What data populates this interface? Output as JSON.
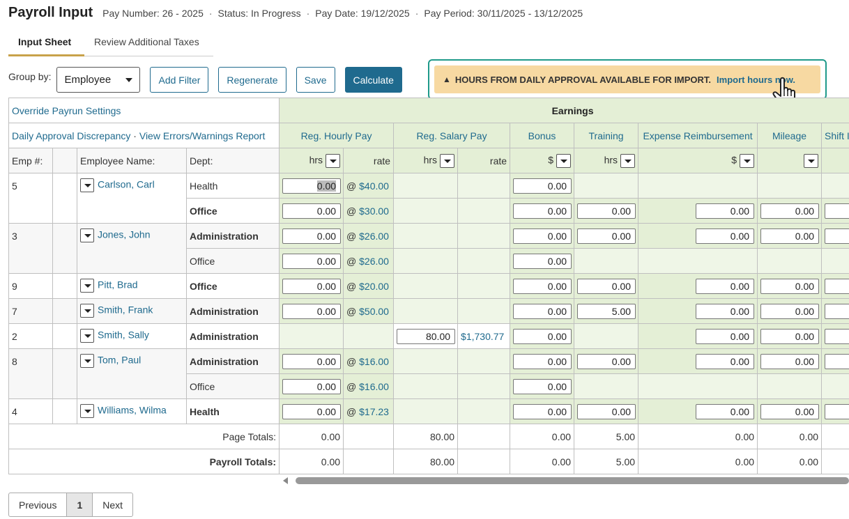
{
  "header": {
    "title": "Payroll Input",
    "pay_number": "Pay Number: 26 - 2025",
    "status": "Status: In Progress",
    "pay_date": "Pay Date: 19/12/2025",
    "pay_period": "Pay Period: 30/11/2025 - 13/12/2025"
  },
  "tabs": [
    "Input Sheet",
    "Review Additional Taxes"
  ],
  "toolbar": {
    "group_by_label": "Group by:",
    "group_by_value": "Employee",
    "add_filter": "Add Filter",
    "regenerate": "Regenerate",
    "save": "Save",
    "calculate": "Calculate"
  },
  "banner": {
    "message": "HOURS FROM DAILY APPROVAL AVAILABLE FOR IMPORT.",
    "link": "Import hours now."
  },
  "grid": {
    "override_link": "Override Payrun Settings",
    "discrepancy_link": "Daily Approval Discrepancy",
    "errors_link": "View Errors/Warnings Report",
    "earnings_header": "Earnings",
    "columns": [
      "Reg. Hourly Pay",
      "Reg. Salary Pay",
      "Bonus",
      "Training",
      "Expense Reimbursement",
      "Mileage",
      "Shift I"
    ],
    "emp_header": "Emp #:",
    "name_header": "Employee Name:",
    "dept_header": "Dept:",
    "unit_hrs": "hrs",
    "unit_rate": "rate",
    "unit_dollar": "$",
    "page_totals_label": "Page Totals:",
    "payroll_totals_label": "Payroll Totals:",
    "page_totals": [
      "0.00",
      "80.00",
      "0.00",
      "5.00",
      "0.00",
      "0.00"
    ],
    "payroll_totals": [
      "0.00",
      "80.00",
      "0.00",
      "5.00",
      "0.00",
      "0.00"
    ],
    "rows": [
      {
        "emp": "5",
        "name": "Carlson, Carl",
        "dept": "Health",
        "reg_hrs": "0.00",
        "rate": "$40.00",
        "bonus": "0.00"
      },
      {
        "dept": "Office",
        "reg_hrs": "0.00",
        "rate": "$30.00",
        "bonus": "0.00",
        "training": "0.00",
        "expense": "0.00",
        "mileage": "0.00"
      },
      {
        "emp": "3",
        "name": "Jones, John",
        "dept": "Administration",
        "reg_hrs": "0.00",
        "rate": "$26.00",
        "bonus": "0.00",
        "training": "0.00",
        "expense": "0.00",
        "mileage": "0.00"
      },
      {
        "dept": "Office",
        "reg_hrs": "0.00",
        "rate": "$26.00",
        "bonus": "0.00"
      },
      {
        "emp": "9",
        "name": "Pitt, Brad",
        "dept": "Office",
        "reg_hrs": "0.00",
        "rate": "$20.00",
        "bonus": "0.00",
        "training": "0.00",
        "expense": "0.00",
        "mileage": "0.00"
      },
      {
        "emp": "7",
        "name": "Smith, Frank",
        "dept": "Administration",
        "reg_hrs": "0.00",
        "rate": "$50.00",
        "bonus": "0.00",
        "training": "5.00",
        "expense": "0.00",
        "mileage": "0.00"
      },
      {
        "emp": "2",
        "name": "Smith, Sally",
        "dept": "Administration",
        "sal_hrs": "80.00",
        "sal_rate": "$1,730.77",
        "bonus": "0.00",
        "expense": "0.00",
        "mileage": "0.00"
      },
      {
        "emp": "8",
        "name": "Tom, Paul",
        "dept": "Administration",
        "reg_hrs": "0.00",
        "rate": "$16.00",
        "bonus": "0.00",
        "training": "0.00",
        "expense": "0.00",
        "mileage": "0.00"
      },
      {
        "dept": "Office",
        "reg_hrs": "0.00",
        "rate": "$16.00",
        "bonus": "0.00"
      },
      {
        "emp": "4",
        "name": "Williams, Wilma",
        "dept": "Health",
        "reg_hrs": "0.00",
        "rate": "$17.23",
        "bonus": "0.00",
        "training": "0.00",
        "expense": "0.00",
        "mileage": "0.00"
      }
    ]
  },
  "pager": {
    "previous": "Previous",
    "current": "1",
    "next": "Next"
  }
}
